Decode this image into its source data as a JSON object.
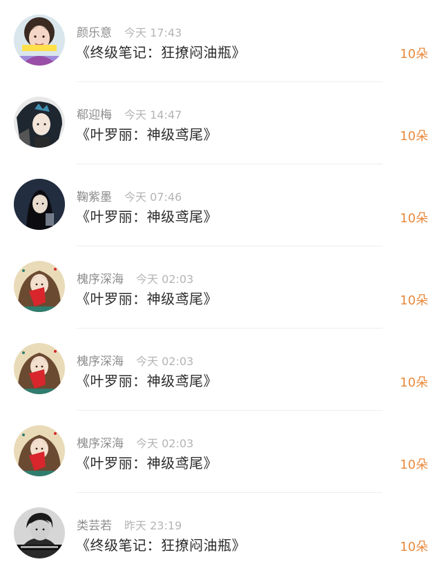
{
  "gift_list": {
    "items": [
      {
        "name": "颜乐意",
        "time": "今天 17:43",
        "title": "《终级笔记：狂撩闷油瓶》",
        "amount": "10朵",
        "avatar": "avatar-girl-photo-icon"
      },
      {
        "name": "郗迎梅",
        "time": "今天 14:47",
        "title": "《叶罗丽：神级鸢尾》",
        "amount": "10朵",
        "avatar": "avatar-anime-boy-icon"
      },
      {
        "name": "鞠紫墨",
        "time": "今天 07:46",
        "title": "《叶罗丽：神级鸢尾》",
        "amount": "10朵",
        "avatar": "avatar-dark-portrait-icon"
      },
      {
        "name": "槐序深海",
        "time": "今天 02:03",
        "title": "《叶罗丽：神级鸢尾》",
        "amount": "10朵",
        "avatar": "avatar-fan-girl-icon"
      },
      {
        "name": "槐序深海",
        "time": "今天 02:03",
        "title": "《叶罗丽：神级鸢尾》",
        "amount": "10朵",
        "avatar": "avatar-fan-girl-icon"
      },
      {
        "name": "槐序深海",
        "time": "今天 02:03",
        "title": "《叶罗丽：神级鸢尾》",
        "amount": "10朵",
        "avatar": "avatar-fan-girl-icon"
      },
      {
        "name": "类芸若",
        "time": "昨天 23:19",
        "title": "《终级笔记：狂撩闷油瓶》",
        "amount": "10朵",
        "avatar": "avatar-bw-boy-icon"
      }
    ]
  },
  "colors": {
    "amount": "#e8893c",
    "name": "#8c8c8c",
    "time": "#b4b4b4",
    "title": "#2b2b2b",
    "divider": "#eeeeee"
  }
}
